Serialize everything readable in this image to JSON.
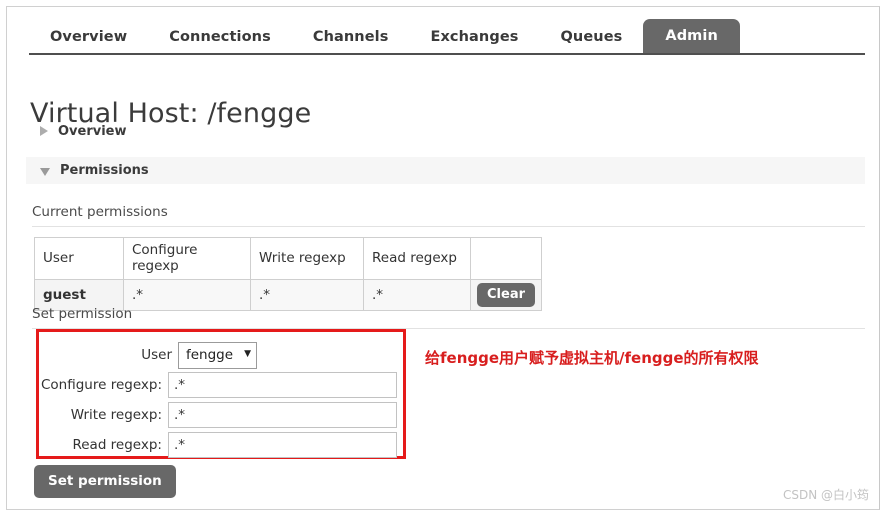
{
  "nav": {
    "tabs": [
      {
        "label": "Overview",
        "active": false
      },
      {
        "label": "Connections",
        "active": false
      },
      {
        "label": "Channels",
        "active": false
      },
      {
        "label": "Exchanges",
        "active": false
      },
      {
        "label": "Queues",
        "active": false
      },
      {
        "label": "Admin",
        "active": true
      }
    ]
  },
  "header": {
    "title": "Virtual Host: /fengge"
  },
  "sections": {
    "overview": {
      "label": "Overview",
      "expanded": false,
      "toggle_icon": "triangle-right-icon"
    },
    "permissions": {
      "label": "Permissions",
      "expanded": true,
      "toggle_icon": "triangle-down-icon"
    }
  },
  "current_permissions": {
    "label": "Current permissions",
    "columns": [
      "User",
      "Configure regexp",
      "Write regexp",
      "Read regexp",
      ""
    ],
    "rows": [
      {
        "user": "guest",
        "configure": ".*",
        "write": ".*",
        "read": ".*",
        "action_label": "Clear"
      }
    ]
  },
  "set_permission": {
    "label": "Set permission",
    "fields": {
      "user_label": "User",
      "user_value": "fengge",
      "user_caret": "▼",
      "configure_label": "Configure regexp:",
      "configure_value": ".*",
      "write_label": "Write regexp:",
      "write_value": ".*",
      "read_label": "Read regexp:",
      "read_value": ".*"
    },
    "submit_label": "Set permission"
  },
  "annotation": {
    "text": "给fengge用户赋予虚拟主机/fengge的所有权限",
    "color": "#d81e1e"
  },
  "watermark": {
    "text": "CSDN @白小筠"
  },
  "colors": {
    "active_tab_bg": "#686868",
    "button_bg": "#686868",
    "annotation_red": "#e51a1a",
    "section_bg": "#f6f6f6"
  }
}
